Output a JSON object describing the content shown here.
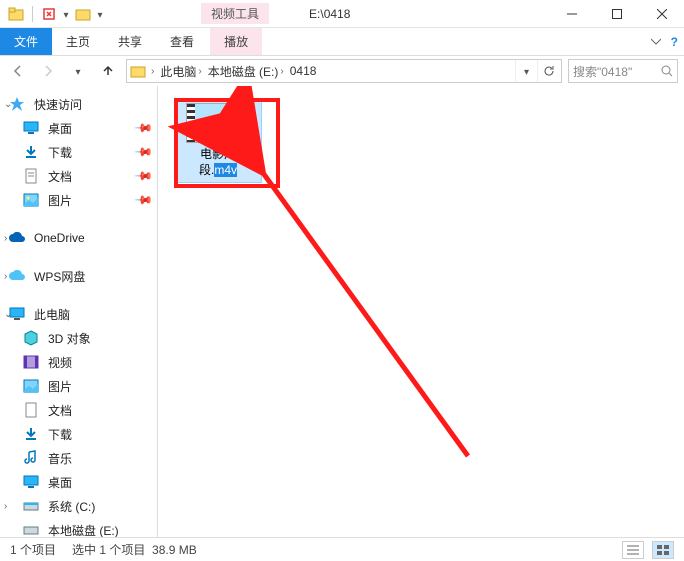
{
  "titlebar": {
    "context_label": "视频工具",
    "path_text": "E:\\0418"
  },
  "ribbon": {
    "file": "文件",
    "home": "主页",
    "share": "共享",
    "view": "查看",
    "play": "播放"
  },
  "address": {
    "crumbs": [
      "此电脑",
      "本地磁盘 (E:)",
      "0418"
    ],
    "search_placeholder": "搜索\"0418\""
  },
  "nav": {
    "quick_access": "快速访问",
    "desktop": "桌面",
    "downloads": "下载",
    "documents": "文档",
    "pictures": "图片",
    "onedrive": "OneDrive",
    "wps": "WPS网盘",
    "this_pc": "此电脑",
    "objects3d": "3D 对象",
    "videos": "视频",
    "pictures2": "图片",
    "documents2": "文档",
    "downloads2": "下载",
    "music": "音乐",
    "desktop2": "桌面",
    "drive_c": "系统 (C:)",
    "drive_e": "本地磁盘 (E:)"
  },
  "file": {
    "name_line1": "电影片",
    "name_line2_prefix": "段.",
    "name_line2_ext": "m4v"
  },
  "status": {
    "count": "1 个项目",
    "selection": "选中 1 个项目",
    "size": "38.9 MB"
  },
  "colors": {
    "accent": "#1e88e5",
    "highlight": "#ff1a1a",
    "pink_context": "#fce4ec"
  }
}
